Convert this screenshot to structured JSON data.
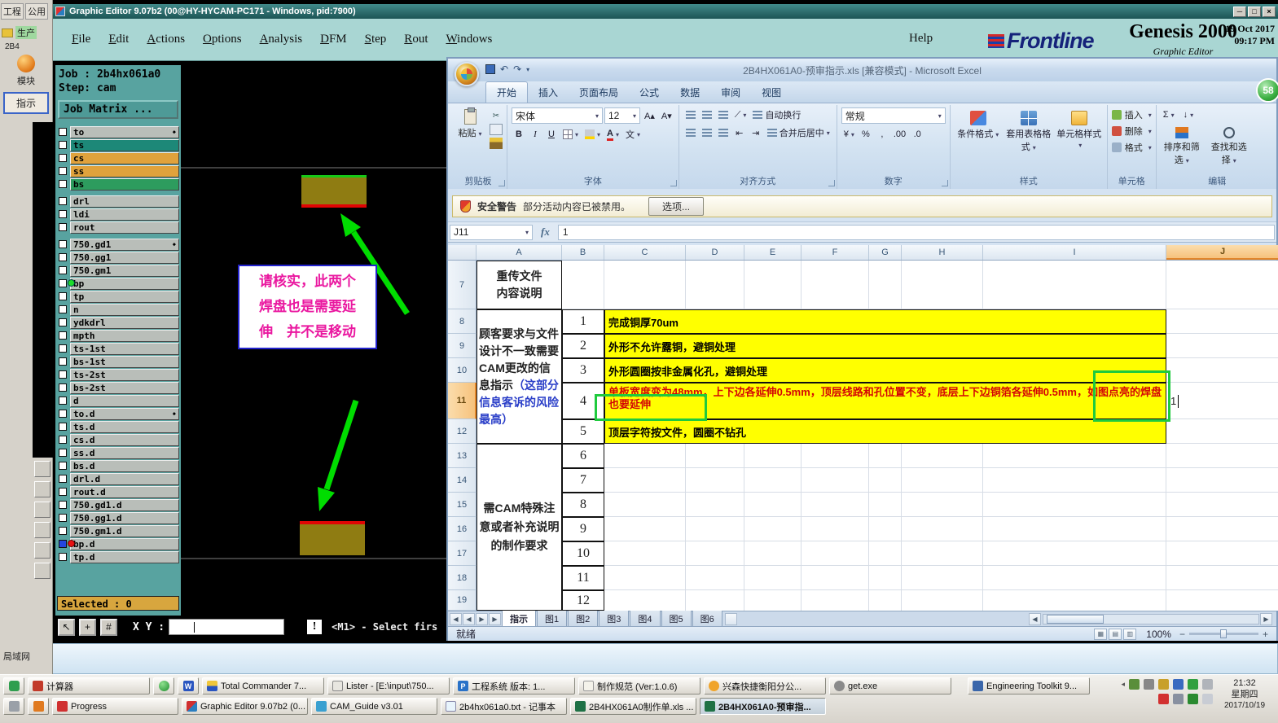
{
  "left_panel": {
    "tabs": [
      "工程",
      "公用"
    ],
    "production_label": "生产",
    "job_short": "2B4",
    "module_label": "模块",
    "instruction_label": "指示",
    "lan_label": "局域网"
  },
  "graphic_editor": {
    "title": "Graphic Editor 9.07b2 (00@HY-HYCAM-PC171 - Windows, pid:7900)",
    "menus": [
      "File",
      "Edit",
      "Actions",
      "Options",
      "Analysis",
      "DFM",
      "Step",
      "Rout",
      "Windows"
    ],
    "help_menu": "Help",
    "brand": {
      "frontline": "Frontline",
      "product": "Genesis 2000",
      "subtitle": "Graphic Editor",
      "date": "19 Oct 2017",
      "time": "09:17 PM"
    },
    "job_label": "Job : 2b4hx061a0",
    "step_label": "Step: cam",
    "matrix_button": "Job Matrix ...",
    "layers": [
      {
        "name": "to",
        "bg": "gray",
        "marker": true
      },
      {
        "name": "ts",
        "bg": "teal"
      },
      {
        "name": "cs",
        "bg": "orange"
      },
      {
        "name": "ss",
        "bg": "orange"
      },
      {
        "name": "bs",
        "bg": "green",
        "gap_after": true
      },
      {
        "name": "drl",
        "bg": "gray"
      },
      {
        "name": "ldi",
        "bg": "gray"
      },
      {
        "name": "rout",
        "bg": "gray",
        "gap_after": true
      },
      {
        "name": "750.gd1",
        "bg": "gray",
        "marker": true
      },
      {
        "name": "750.gg1",
        "bg": "gray"
      },
      {
        "name": "750.gm1",
        "bg": "gray"
      },
      {
        "name": "bp",
        "bg": "gray",
        "dot": "green"
      },
      {
        "name": "tp",
        "bg": "gray"
      },
      {
        "name": "n",
        "bg": "gray"
      },
      {
        "name": "ydkdrl",
        "bg": "gray"
      },
      {
        "name": "mpth",
        "bg": "gray"
      },
      {
        "name": "ts-1st",
        "bg": "gray"
      },
      {
        "name": "bs-1st",
        "bg": "gray"
      },
      {
        "name": "ts-2st",
        "bg": "gray"
      },
      {
        "name": "bs-2st",
        "bg": "gray"
      },
      {
        "name": "d",
        "bg": "gray"
      },
      {
        "name": "to.d",
        "bg": "gray",
        "marker": true
      },
      {
        "name": "ts.d",
        "bg": "gray"
      },
      {
        "name": "cs.d",
        "bg": "gray"
      },
      {
        "name": "ss.d",
        "bg": "gray"
      },
      {
        "name": "bs.d",
        "bg": "gray"
      },
      {
        "name": "drl.d",
        "bg": "gray"
      },
      {
        "name": "rout.d",
        "bg": "gray"
      },
      {
        "name": "750.gd1.d",
        "bg": "gray"
      },
      {
        "name": "750.gg1.d",
        "bg": "gray"
      },
      {
        "name": "750.gm1.d",
        "bg": "gray"
      },
      {
        "name": "bp.d",
        "bg": "gray",
        "dot": "red",
        "checked": true
      },
      {
        "name": "tp.d",
        "bg": "gray"
      }
    ],
    "selected_label": "Selected : 0",
    "xy_label": "X Y :",
    "prompt_button": "!",
    "status_hint": "<M1> - Select firs",
    "note_lines": [
      "请核实，此两个",
      "焊盘也是需要延",
      "伸　并不是移动"
    ]
  },
  "excel": {
    "title": "2B4HX061A0-预审指示.xls  [兼容模式] - Microsoft Excel",
    "ribbon_tabs": [
      "开始",
      "插入",
      "页面布局",
      "公式",
      "数据",
      "审阅",
      "视图"
    ],
    "active_tab": "开始",
    "ribbon": {
      "groups": [
        "剪贴板",
        "字体",
        "对齐方式",
        "数字",
        "样式",
        "单元格",
        "编辑"
      ],
      "paste": "粘贴",
      "font_name": "宋体",
      "font_size": "12",
      "wrap_text": "自动换行",
      "merge_center": "合并后居中",
      "number_format": "常规",
      "cond_format": "条件格式",
      "table_format": "套用表格格式",
      "cell_styles": "单元格样式",
      "insert": "插入",
      "delete": "删除",
      "format": "格式",
      "sort_filter": "排序和筛选",
      "find_select": "查找和选择"
    },
    "security_bar": {
      "title": "安全警告",
      "message": "部分活动内容已被禁用。",
      "button": "选项..."
    },
    "name_box": "J11",
    "formula_value": "1",
    "columns": [
      "A",
      "B",
      "C",
      "D",
      "E",
      "F",
      "G",
      "H",
      "I",
      "J"
    ],
    "selected_column": "J",
    "row_numbers": [
      7,
      8,
      9,
      10,
      11,
      12,
      13,
      14,
      15,
      16,
      17,
      18,
      19
    ],
    "selected_row": 11,
    "cells": {
      "a7": "重传文件\n内容说明",
      "a8_12_main": "顾客要求与文件设计不一致需要CAM更改的信息指示",
      "a8_12_note": "（这部分信息客诉的风险最高）",
      "a13_19": "需CAM特殊注意或者补充说明的制作要求",
      "j11": "1",
      "items": [
        {
          "num": "1",
          "text": "完成铜厚70um"
        },
        {
          "num": "2",
          "text": "外形不允许露铜，避铜处理"
        },
        {
          "num": "3",
          "text": "外形圆圈按非金属化孔，避铜处理"
        },
        {
          "num": "4",
          "text": "单板宽度变为48mm，上下边各延伸0.5mm，顶层线路和孔位置不变，底层上下边铜箔各延伸0.5mm，如图点亮的焊盘也要延伸",
          "red": true
        },
        {
          "num": "5",
          "text": "顶层字符按文件，圆圈不钻孔"
        },
        {
          "num": "6",
          "text": ""
        },
        {
          "num": "7",
          "text": ""
        },
        {
          "num": "8",
          "text": ""
        },
        {
          "num": "9",
          "text": ""
        },
        {
          "num": "10",
          "text": ""
        },
        {
          "num": "11",
          "text": ""
        },
        {
          "num": "12",
          "text": ""
        }
      ]
    },
    "sheet_tabs": [
      "指示",
      "图1",
      "图2",
      "图3",
      "图4",
      "图5",
      "图6"
    ],
    "active_sheet": "指示",
    "status_ready": "就绪",
    "zoom": "100%"
  },
  "overlay_badge": "58",
  "taskbar": {
    "row1": [
      {
        "icon": "green-app",
        "label": ""
      },
      {
        "icon": "calculator",
        "label": "计算器"
      },
      {
        "icon": "green-ball",
        "label": ""
      },
      {
        "icon": "word",
        "label": "",
        "icon_text": "W"
      },
      {
        "icon": "total-commander",
        "label": "Total Commander 7..."
      },
      {
        "icon": "lister",
        "label": "Lister - [E:\\input\\750..."
      },
      {
        "icon": "eng-system",
        "label": "工程系统  版本: 1...",
        "icon_text": "P"
      },
      {
        "icon": "document",
        "label": "制作规范 (Ver:1.0.6)"
      },
      {
        "icon": "star",
        "label": "兴森快捷衡阳分公..."
      },
      {
        "icon": "gear",
        "label": "get.exe"
      },
      {
        "icon": "toolkit",
        "label": "Engineering Toolkit 9..."
      }
    ],
    "row2": [
      {
        "icon": "system",
        "label": ""
      },
      {
        "icon": "orange-app",
        "label": ""
      },
      {
        "icon": "progress",
        "label": "Progress"
      },
      {
        "icon": "graphic-editor",
        "label": "Graphic Editor 9.07b2 (0..."
      },
      {
        "icon": "cam-guide",
        "label": "CAM_Guide v3.01"
      },
      {
        "icon": "notepad",
        "label": "2b4hx061a0.txt - 记事本"
      },
      {
        "icon": "excel",
        "label": "2B4HX061A0制作单.xls ..."
      },
      {
        "icon": "excel",
        "label": "2B4HX061A0-预审指...",
        "active": true
      }
    ],
    "tray_row1": [
      "#5a8e3a",
      "#888888",
      "#c8a02a",
      "#3a6ac0",
      "#30a040",
      "#b0b4ba"
    ],
    "tray_row2": [
      "#d23030",
      "#8890a0",
      "#2a8a30",
      "#c8ccd4"
    ],
    "clock": "21:32",
    "weekday": "星期四",
    "date": "2017/10/19"
  }
}
